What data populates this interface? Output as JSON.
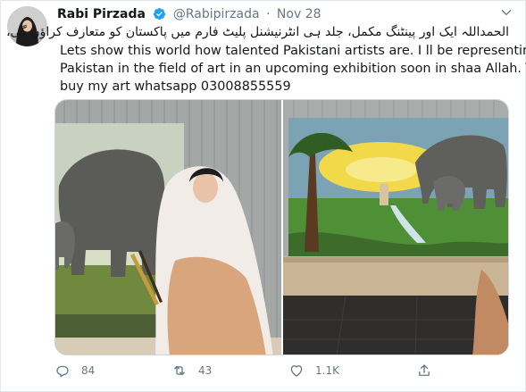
{
  "tweet": {
    "author_name": "Rabi Pirzada",
    "handle": "@Rabipirzada",
    "separator": "·",
    "date": "Nov 28",
    "text_urdu": "الحمداللہ ایک اور پینٹنگ مکمل، جلد ہی انٹرنیشنل پلیٹ فارم میں پاکستان کو متعارف کراؤں گی،",
    "text_english_lines": [
      "Lets show this world how talented Pakistani artists are. I ll be representing",
      "Pakistan in the field of art in an upcoming exhibition soon in shaa Allah. To",
      "buy my art whatsapp 03008855559"
    ]
  },
  "actions": {
    "reply_count": "84",
    "retweet_count": "43",
    "like_count": "1.1K",
    "share_count": ""
  },
  "icons": {
    "verified": "verified-badge-icon",
    "more": "chevron-down-icon",
    "reply": "reply-icon",
    "retweet": "retweet-icon",
    "like": "heart-icon",
    "share": "share-icon"
  },
  "colors": {
    "verified_blue": "#1da1f2",
    "muted_text": "#657786",
    "border": "#e1e8ed"
  }
}
